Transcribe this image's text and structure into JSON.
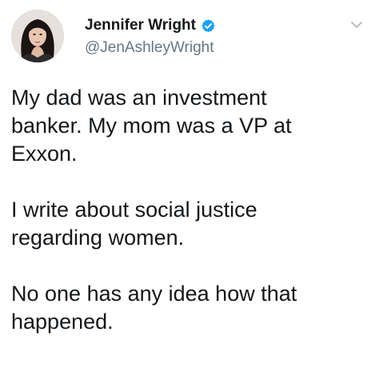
{
  "author": {
    "display_name": "Jennifer Wright",
    "handle": "@JenAshleyWright",
    "verified": true,
    "avatar_icon": "profile-photo"
  },
  "tweet": {
    "paragraphs": [
      [
        "My dad was an investment",
        "banker. My mom was a VP at",
        "Exxon."
      ],
      [
        "I write about social justice",
        "regarding women."
      ],
      [
        "No one has any idea how that",
        "happened."
      ]
    ]
  },
  "menu": {
    "icon": "chevron-down-icon"
  },
  "colors": {
    "verified_badge": "#1da1f2",
    "handle": "#657786",
    "text": "#14171a"
  }
}
